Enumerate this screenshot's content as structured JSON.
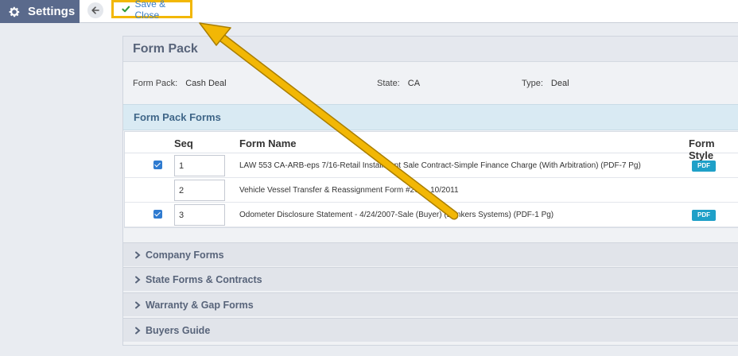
{
  "topbar": {
    "settings_label": "Settings",
    "back_icon": "arrow-left-icon",
    "save_close_label": "Save & Close"
  },
  "panel": {
    "title": "Form Pack",
    "info": {
      "pack_label": "Form Pack:",
      "pack_value": "Cash Deal",
      "state_label": "State:",
      "state_value": "CA",
      "type_label": "Type:",
      "type_value": "Deal"
    },
    "forms_section_title": "Form Pack Forms",
    "table": {
      "headers": {
        "seq": "Seq",
        "name": "Form Name",
        "style": "Form Style"
      },
      "rows": [
        {
          "checked": true,
          "seq": "1",
          "name": "LAW 553 CA-ARB-eps 7/16-Retail Installment Sale Contract-Simple Finance Charge (With Arbitration) (PDF-7 Pg)",
          "style": "PDF"
        },
        {
          "checked": false,
          "seq": "2",
          "name": "Vehicle Vessel Transfer & Reassignment Form #262 - 10/2011",
          "style": ""
        },
        {
          "checked": true,
          "seq": "3",
          "name": "Odometer Disclosure Statement - 4/24/2007-Sale (Buyer) (Bankers Systems) (PDF-1 Pg)",
          "style": "PDF"
        }
      ]
    },
    "accordions": [
      "Company Forms",
      "State Forms & Contracts",
      "Warranty & Gap Forms",
      "Buyers Guide"
    ]
  },
  "colors": {
    "settings_tab": "#5a6a8c",
    "highlight": "#f2b705",
    "pdf_badge": "#1fa0c8",
    "section_blue": "#d9eaf3"
  }
}
